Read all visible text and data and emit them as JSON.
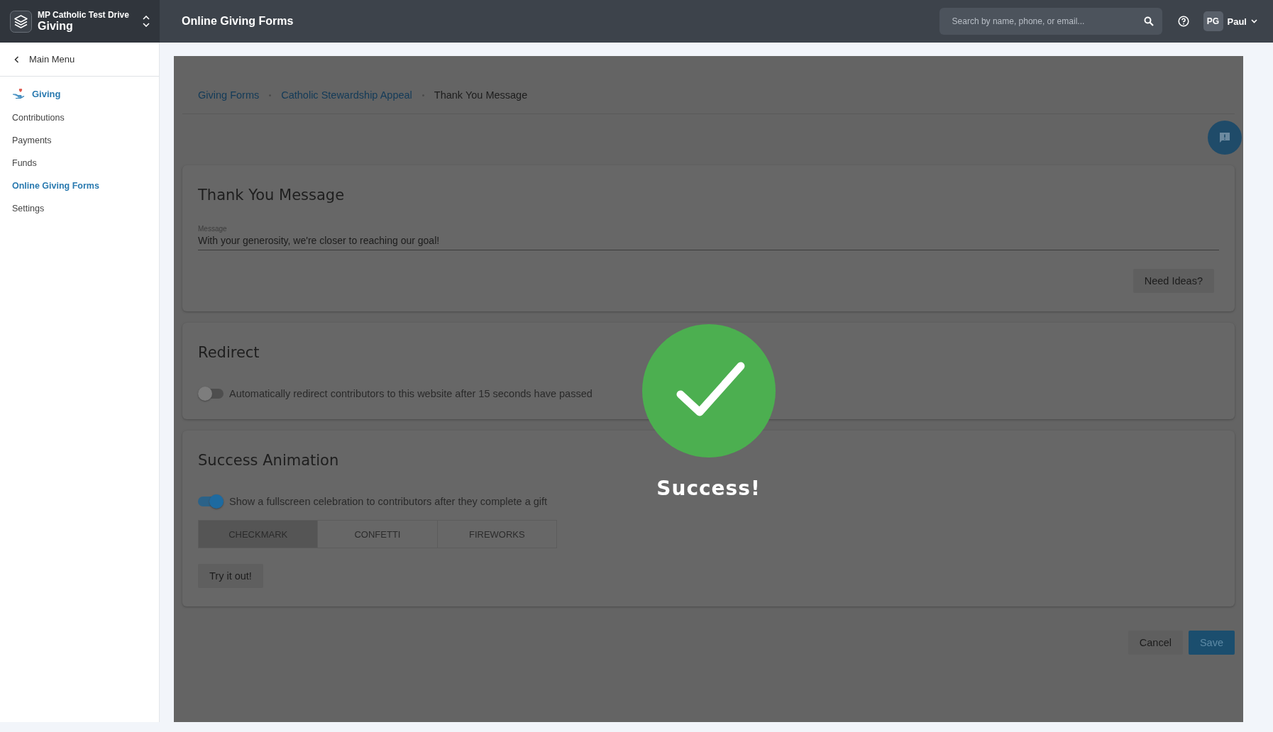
{
  "app": {
    "org": "MP Catholic Test Drive",
    "module": "Giving"
  },
  "header": {
    "title": "Online Giving Forms",
    "search": {
      "placeholder": "Search by name, phone, or email..."
    },
    "user": {
      "initials": "PG",
      "name": "Paul"
    }
  },
  "sidebar": {
    "back": "Main Menu",
    "section": "Giving",
    "items": [
      {
        "label": "Contributions",
        "selected": false
      },
      {
        "label": "Payments",
        "selected": false
      },
      {
        "label": "Funds",
        "selected": false
      },
      {
        "label": "Online Giving Forms",
        "selected": true
      },
      {
        "label": "Settings",
        "selected": false
      }
    ]
  },
  "breadcrumbs": [
    {
      "label": "Giving Forms",
      "current": false
    },
    {
      "label": "Catholic Stewardship Appeal",
      "current": false
    },
    {
      "label": "Thank You Message",
      "current": true
    }
  ],
  "thank_you": {
    "title": "Thank You Message",
    "message": {
      "label": "Message",
      "value": "With your generosity, we're closer to reaching our goal!"
    },
    "ideas_button": "Need Ideas?"
  },
  "redirect": {
    "title": "Redirect",
    "toggle": {
      "on": false,
      "label": "Automatically redirect contributors to this website after 15 seconds have passed"
    }
  },
  "success_animation": {
    "title": "Success Animation",
    "toggle": {
      "on": true,
      "label": "Show a fullscreen celebration to contributors after they complete a gift"
    },
    "options": [
      {
        "label": "CHECKMARK",
        "selected": true
      },
      {
        "label": "CONFETTI",
        "selected": false
      },
      {
        "label": "FIREWORKS",
        "selected": false
      }
    ],
    "try_button": "Try it out!"
  },
  "actions": {
    "cancel": "Cancel",
    "save": "Save"
  },
  "overlay": {
    "message": "Success!"
  }
}
